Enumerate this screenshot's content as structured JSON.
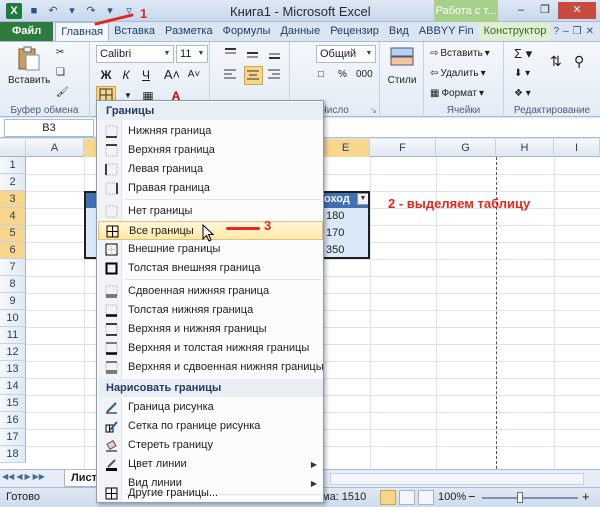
{
  "window": {
    "title": "Книга1 - Microsoft Excel",
    "contextual_group": "Работа с т..."
  },
  "tabs": [
    {
      "label": "Файл"
    },
    {
      "label": "Главная"
    },
    {
      "label": "Вставка"
    },
    {
      "label": "Разметка"
    },
    {
      "label": "Формулы"
    },
    {
      "label": "Данные"
    },
    {
      "label": "Рецензир"
    },
    {
      "label": "Вид"
    },
    {
      "label": "ABBYY Fin"
    },
    {
      "label": "Конструктор"
    }
  ],
  "ribbon": {
    "clipboard": {
      "paste": "Вставить",
      "label": "Буфер обмена"
    },
    "font": {
      "name": "Calibri",
      "size": "11"
    },
    "number": {
      "format": "Общий",
      "label": "Число"
    },
    "styles": {
      "label": "Стили"
    },
    "cells": {
      "insert": "Вставить",
      "delete": "Удалить",
      "format": "Формат",
      "label": "Ячейки"
    },
    "editing": {
      "label": "Редактирование"
    }
  },
  "formula_bar": {
    "name_box": "B3"
  },
  "grid": {
    "columns": [
      "A",
      "E",
      "F",
      "G",
      "H",
      "I"
    ],
    "rows": [
      "1",
      "2",
      "3",
      "4",
      "5",
      "6",
      "7",
      "8",
      "9",
      "10",
      "11",
      "12",
      "13",
      "14",
      "15",
      "16",
      "17",
      "18"
    ],
    "header_cell": "оход",
    "values": [
      "180",
      "170",
      "350"
    ]
  },
  "menu": {
    "section_borders": "Границы",
    "items_a": [
      {
        "label": "Нижняя граница",
        "icon": "border-bottom-icon"
      },
      {
        "label": "Верхняя граница",
        "icon": "border-top-icon"
      },
      {
        "label": "Левая граница",
        "icon": "border-left-icon"
      },
      {
        "label": "Правая граница",
        "icon": "border-right-icon"
      }
    ],
    "items_b": [
      {
        "label": "Нет границы",
        "icon": "no-border-icon"
      },
      {
        "label": "Все границы",
        "icon": "all-borders-icon"
      },
      {
        "label": "Внешние границы",
        "icon": "outside-borders-icon"
      },
      {
        "label": "Толстая внешняя граница",
        "icon": "thick-outside-border-icon"
      }
    ],
    "items_c": [
      {
        "label": "Сдвоенная нижняя граница",
        "icon": "double-bottom-border-icon"
      },
      {
        "label": "Толстая нижняя граница",
        "icon": "thick-bottom-border-icon"
      },
      {
        "label": "Верхняя и нижняя границы",
        "icon": "top-bottom-border-icon"
      },
      {
        "label": "Верхняя и толстая нижняя границы",
        "icon": "top-thick-bottom-border-icon"
      },
      {
        "label": "Верхняя и сдвоенная нижняя границы",
        "icon": "top-double-bottom-border-icon"
      }
    ],
    "section_draw": "Нарисовать границы",
    "items_d": [
      {
        "label": "Граница рисунка",
        "icon": "draw-border-icon"
      },
      {
        "label": "Сетка по границе рисунка",
        "icon": "draw-grid-icon"
      },
      {
        "label": "Стереть границу",
        "icon": "eraser-icon"
      },
      {
        "label": "Цвет линии",
        "icon": "line-color-icon"
      },
      {
        "label": "Вид линии",
        "icon": "line-style-icon"
      }
    ],
    "more": "Другие границы..."
  },
  "annotations": {
    "step1": "1",
    "step2": "2 - выделяем таблицу",
    "step3": "3"
  },
  "sheets": {
    "active": "Лист1"
  },
  "status": {
    "ready": "Готово",
    "count": "ма: 1510",
    "zoom": "100%"
  },
  "colors": {
    "file_tab": "#2f7b3d",
    "table_header": "#3f6fb5",
    "table_fill": "#dbe8f7",
    "annotation": "#e8261d"
  }
}
